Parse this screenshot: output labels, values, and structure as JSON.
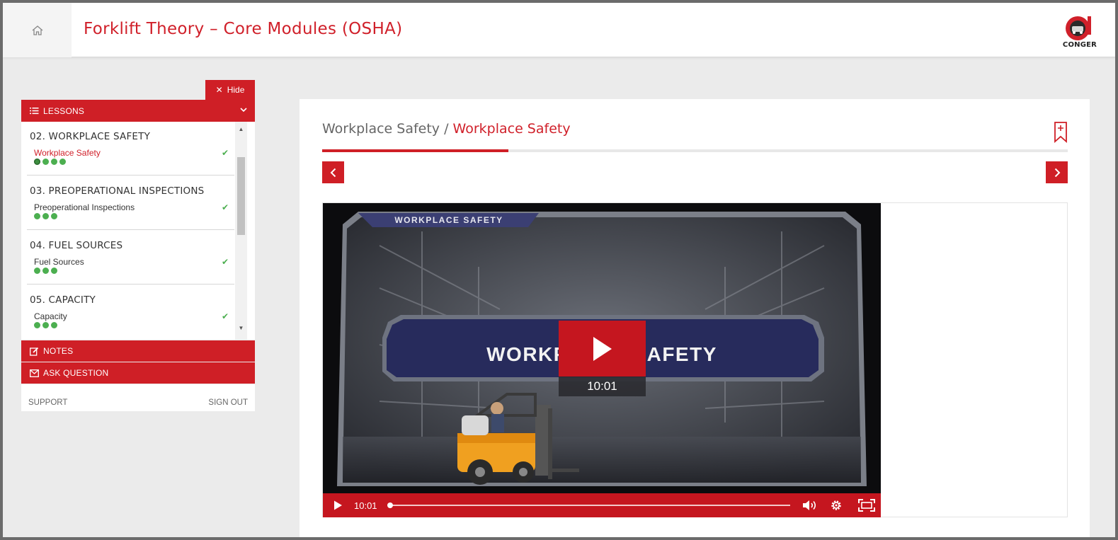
{
  "header": {
    "title": "Forklift Theory – Core Modules (OSHA)",
    "logo_text": "CONGER"
  },
  "sidebar": {
    "hide_label": "Hide",
    "lessons_label": "LESSONS",
    "lessons": [
      {
        "title": "02. WORKPLACE SAFETY",
        "item": "Workplace Safety",
        "dots": 4,
        "active": true
      },
      {
        "title": "03. PREOPERATIONAL INSPECTIONS",
        "item": "Preoperational Inspections",
        "dots": 3,
        "active": false
      },
      {
        "title": "04. FUEL SOURCES",
        "item": "Fuel Sources",
        "dots": 3,
        "active": false
      },
      {
        "title": "05. CAPACITY",
        "item": "Capacity",
        "dots": 3,
        "active": false
      }
    ],
    "notes_label": "NOTES",
    "ask_label": "ASK QUESTION",
    "support_label": "SUPPORT",
    "signout_label": "SIGN OUT"
  },
  "main": {
    "breadcrumb_parent": "Workplace Safety",
    "breadcrumb_sep": " / ",
    "breadcrumb_current": "Workplace Safety",
    "progress_fraction": 0.25
  },
  "video": {
    "banner_small": "WORKPLACE SAFETY",
    "banner_title": "WORKPLACE SAFETY",
    "duration": "10:01",
    "current_time": "10:01"
  },
  "colors": {
    "brand_red": "#cf1f26",
    "complete_green": "#4caf50"
  }
}
